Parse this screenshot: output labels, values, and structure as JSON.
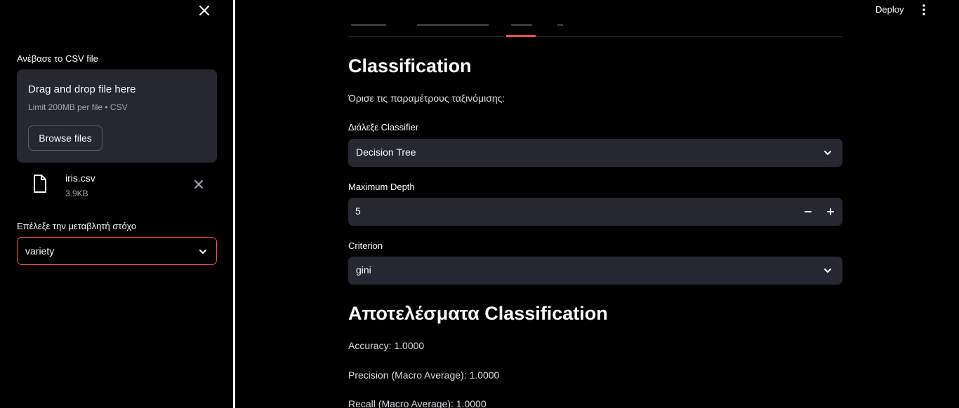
{
  "sidebar": {
    "upload_label": "Ανέβασε το CSV file",
    "dropzone": {
      "title": "Drag and drop file here",
      "subtitle": "Limit 200MB per file • CSV",
      "browse_label": "Browse files"
    },
    "uploaded_file": {
      "name": "iris.csv",
      "size": "3.9KB"
    },
    "target_label": "Επέλεξε την μεταβλητή στόχο",
    "target_value": "variety",
    "close_icon": "close-icon"
  },
  "header": {
    "deploy_label": "Deploy",
    "menu_icon": "kebab-menu-icon"
  },
  "main": {
    "section_title": "Classification",
    "intro": "Όρισε τις παραμέτρους ταξινόμισης:",
    "classifier_label": "Διάλεξε Classifier",
    "classifier_value": "Decision Tree",
    "depth_label": "Maximum Depth",
    "depth_value": "5",
    "criterion_label": "Criterion",
    "criterion_value": "gini",
    "results_title": "Αποτελέσματα Classification",
    "accuracy": "Accuracy: 1.0000",
    "precision": "Precision (Macro Average): 1.0000",
    "recall": "Recall (Macro Average): 1.0000"
  },
  "colors": {
    "accent": "#ff4b4b",
    "widget_bg": "#262730",
    "background": "#000000"
  }
}
